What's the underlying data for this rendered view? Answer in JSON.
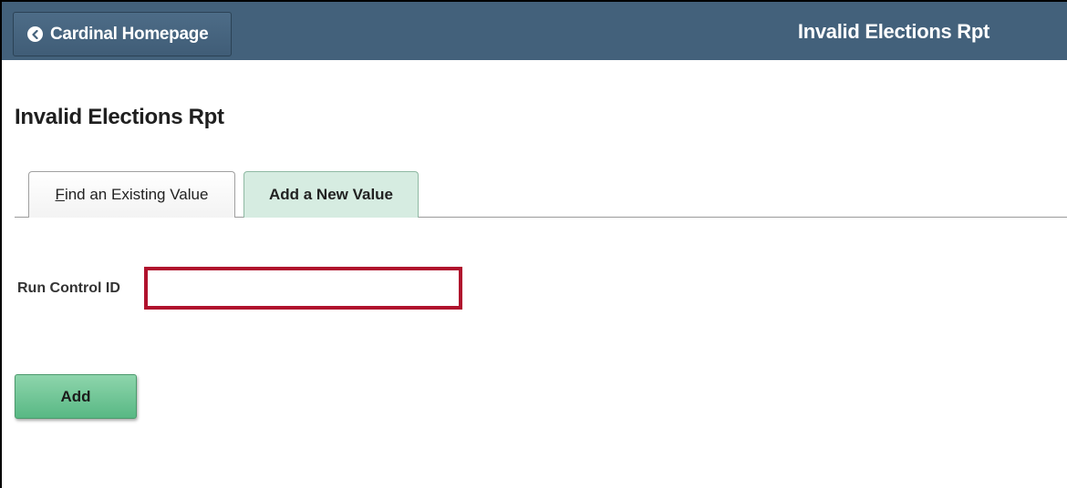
{
  "banner": {
    "home_button_label": "Cardinal Homepage",
    "back_icon": "chevron-left-circle-icon",
    "title": "Invalid Elections Rpt"
  },
  "page": {
    "title": "Invalid Elections Rpt"
  },
  "tabs": [
    {
      "label": "Find an Existing Value",
      "active": false
    },
    {
      "label": "Add a New Value",
      "active": true
    }
  ],
  "form": {
    "run_control_label": "Run Control ID",
    "run_control_value": "",
    "add_button_label": "Add"
  },
  "colors": {
    "banner": "#43617b",
    "active_tab": "#d6ece1",
    "highlight_border": "#b0122d",
    "add_button": "#58b884"
  }
}
